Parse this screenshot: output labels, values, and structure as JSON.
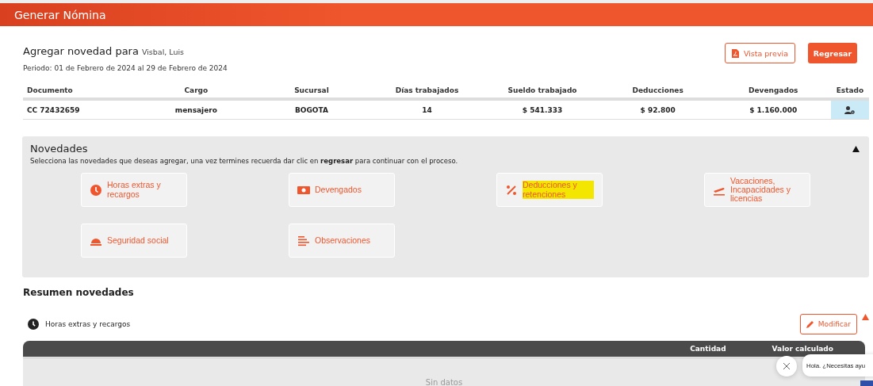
{
  "header": {
    "title": "Generar Nómina"
  },
  "employee": {
    "heading": "Agregar novedad para",
    "name": "Visbal, Luis",
    "period": "Periodo: 01 de Febrero de 2024 al 29 de Febrero de 2024"
  },
  "actions": {
    "preview": "Vista previa",
    "back": "Regresar"
  },
  "table": {
    "columns": [
      "Documento",
      "Cargo",
      "Sucursal",
      "Días trabajados",
      "Sueldo trabajado",
      "Deducciones",
      "Devengados",
      "Estado"
    ],
    "rows": [
      {
        "cells": [
          "CC 72432659",
          "mensajero",
          "BOGOTA",
          "14",
          "$ 541.333",
          "$ 92.800",
          "$ 1.160.000"
        ]
      }
    ]
  },
  "novedades": {
    "title": "Novedades",
    "expanded": true,
    "description": "Selecciona las novedades que deseas agregar, una vez termines recuerda dar clic en **regresar** para continuar con el proceso.",
    "options": [
      {
        "kind": "clock",
        "label": "Horas extras y recargos",
        "highlighted": false
      },
      {
        "kind": "money",
        "label": "Devengados",
        "highlighted": false
      },
      {
        "kind": "percent",
        "label": "Deducciones y retenciones",
        "highlighted": true
      },
      {
        "kind": "plane",
        "label": "Vacaciones, Incapacidades y licencias",
        "highlighted": false
      },
      {
        "kind": "helmet",
        "label": "Seguridad social",
        "highlighted": false
      },
      {
        "kind": "lines",
        "label": "Observaciones",
        "highlighted": false
      }
    ]
  },
  "summary": {
    "title": "Resumen novedades",
    "section": "Horas extras y recargos",
    "edit": "Modificar",
    "expanded": true,
    "columns": [
      "Cantidad",
      "Valor calculado"
    ],
    "empty": "Sin datos"
  },
  "chat": {
    "message": "Hola. ¿Necesitas ayu"
  }
}
